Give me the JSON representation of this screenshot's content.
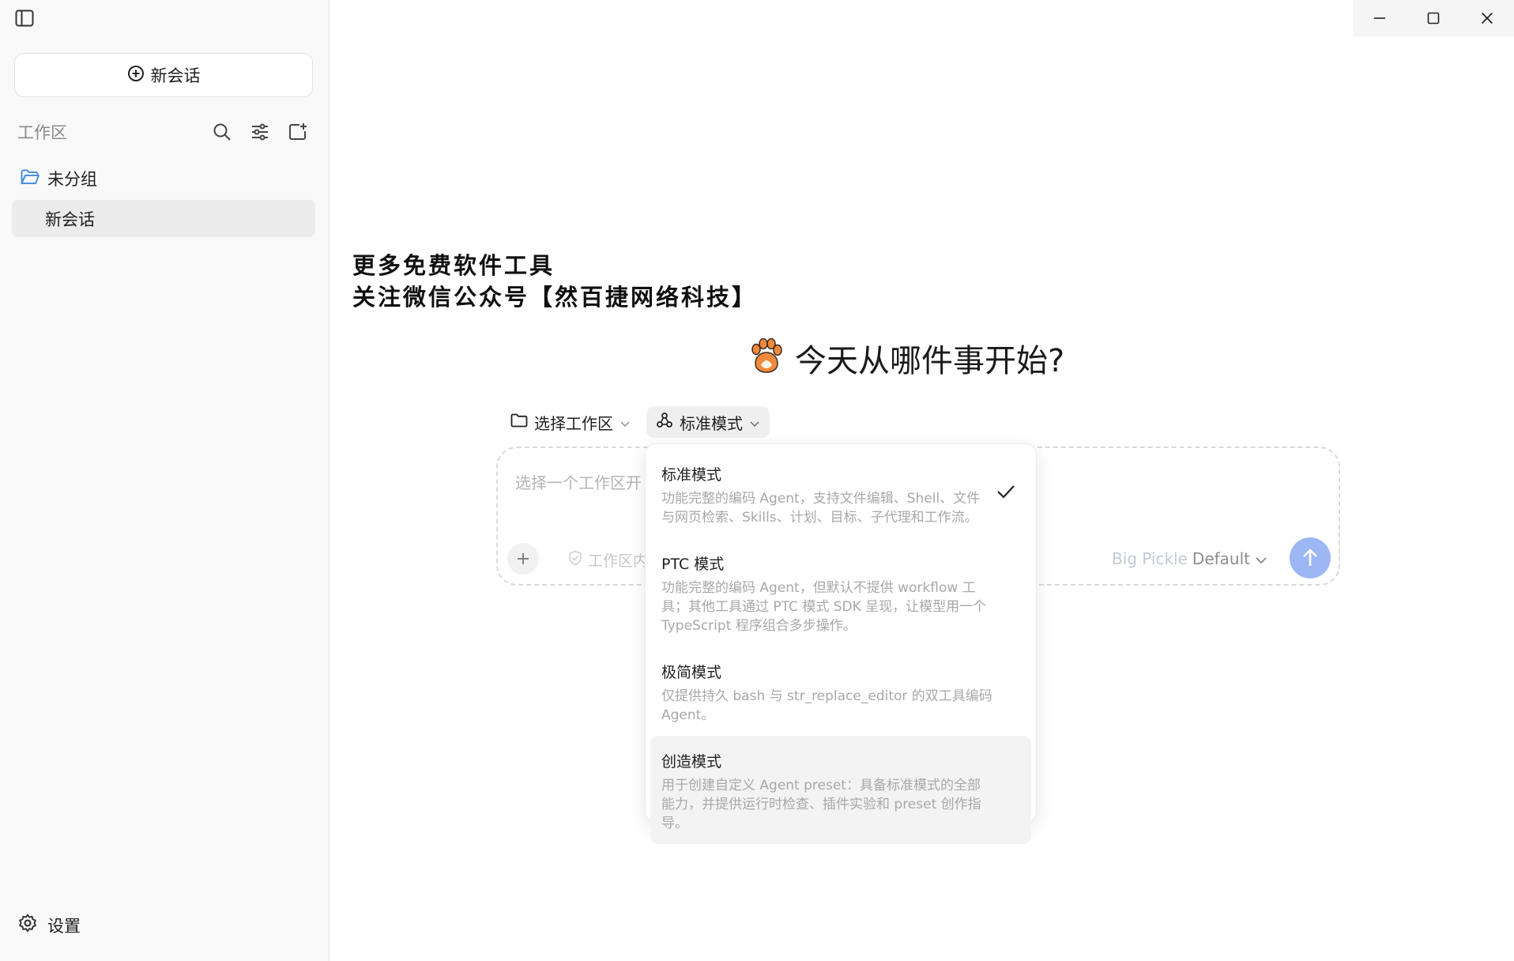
{
  "sidebar": {
    "new_chat_label": "新会话",
    "workspace_title": "工作区",
    "group_label": "未分组",
    "session_label": "新会话",
    "settings_label": "设置"
  },
  "watermark": {
    "line1": "更多免费软件工具",
    "line2": "关注微信公众号【然百捷网络科技】"
  },
  "main": {
    "hero_title": "今天从哪件事开始?",
    "workspace_pill": "选择工作区",
    "mode_pill": "标准模式",
    "input_placeholder": "选择一个工作区开",
    "workspace_scope": "工作区内",
    "model_name": "Big Pickle",
    "model_variant": "Default"
  },
  "mode_menu": {
    "options": [
      {
        "name": "标准模式",
        "desc": "功能完整的编码 Agent，支持文件编辑、Shell、文件与网页检索、Skills、计划、目标、子代理和工作流。",
        "selected": true
      },
      {
        "name": "PTC 模式",
        "desc": "功能完整的编码 Agent，但默认不提供 workflow 工具；其他工具通过 PTC 模式 SDK 呈现，让模型用一个 TypeScript 程序组合多步操作。",
        "selected": false
      },
      {
        "name": "极简模式",
        "desc": "仅提供持久 bash 与 str_replace_editor 的双工具编码 Agent。",
        "selected": false
      },
      {
        "name": "创造模式",
        "desc": "用于创建自定义 Agent preset：具备标准模式的全部能力，并提供运行时检查、插件实验和 preset 创作指导。",
        "selected": false
      }
    ]
  },
  "colors": {
    "accent_folder": "#4a90e2",
    "send_button": "#9db7f5"
  }
}
